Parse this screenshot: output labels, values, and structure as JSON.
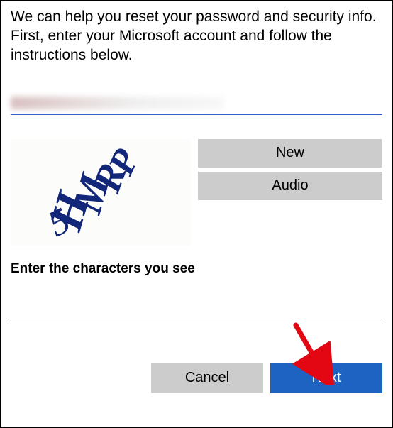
{
  "instructions": "We can help you reset your password and security info. First, enter your Microsoft account and follow the instructions below.",
  "emailField": {
    "redacted": true
  },
  "captcha": {
    "chars": "5HMRP",
    "newLabel": "New",
    "audioLabel": "Audio",
    "prompt": "Enter the characters you see"
  },
  "buttons": {
    "cancel": "Cancel",
    "next": "Next"
  }
}
